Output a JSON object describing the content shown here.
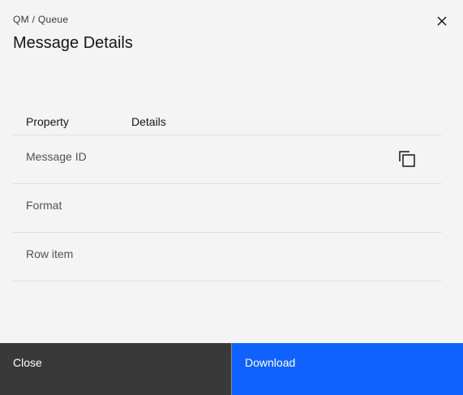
{
  "header": {
    "breadcrumb": "QM / Queue",
    "title": "Message Details",
    "close_icon": "close-icon"
  },
  "table": {
    "columns": [
      "Property",
      "Details"
    ],
    "rows": [
      {
        "property": "Message ID",
        "details": "",
        "action_icon": "copy-icon"
      },
      {
        "property": "Format",
        "details": ""
      },
      {
        "property": "Row item",
        "details": ""
      }
    ]
  },
  "footer": {
    "close_label": "Close",
    "download_label": "Download"
  },
  "colors": {
    "background": "#f4f4f4",
    "secondary_button": "#393939",
    "primary_button": "#0f62fe",
    "divider": "#e0e0e0"
  }
}
